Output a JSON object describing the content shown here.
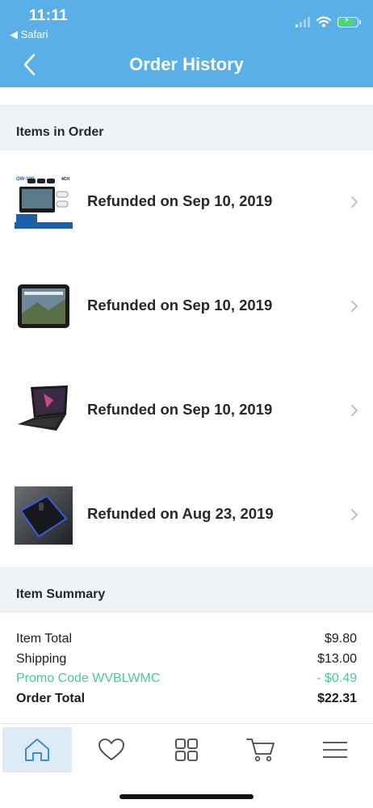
{
  "status_bar": {
    "time": "11:11",
    "back_app": "◀ Safari"
  },
  "nav": {
    "title": "Order History"
  },
  "items_section": {
    "title": "Items in Order",
    "items": [
      {
        "status": "Refunded on Sep 10, 2019",
        "thumbnail": "security-camera-kit-image"
      },
      {
        "status": "Refunded on Sep 10, 2019",
        "thumbnail": "tablet-image"
      },
      {
        "status": "Refunded on Sep 10, 2019",
        "thumbnail": "laptop-image"
      },
      {
        "status": "Refunded on Aug 23, 2019",
        "thumbnail": "phone-case-image"
      }
    ]
  },
  "summary_section": {
    "title": "Item Summary",
    "item_total_label": "Item Total",
    "item_total_value": "$9.80",
    "shipping_label": "Shipping",
    "shipping_value": "$13.00",
    "promo_label": "Promo Code WVBLWMC",
    "promo_value": "- $0.49",
    "order_total_label": "Order Total",
    "order_total_value": "$22.31"
  },
  "tab_bar": {
    "tabs": [
      {
        "icon": "home-icon",
        "active": true
      },
      {
        "icon": "heart-icon",
        "active": false
      },
      {
        "icon": "grid-icon",
        "active": false
      },
      {
        "icon": "cart-icon",
        "active": false
      },
      {
        "icon": "menu-icon",
        "active": false
      }
    ]
  },
  "colors": {
    "header": "#5ab0e6",
    "section_bg": "#eef3f7",
    "promo": "#48c9a0",
    "active_tab": "#dcebf5"
  }
}
